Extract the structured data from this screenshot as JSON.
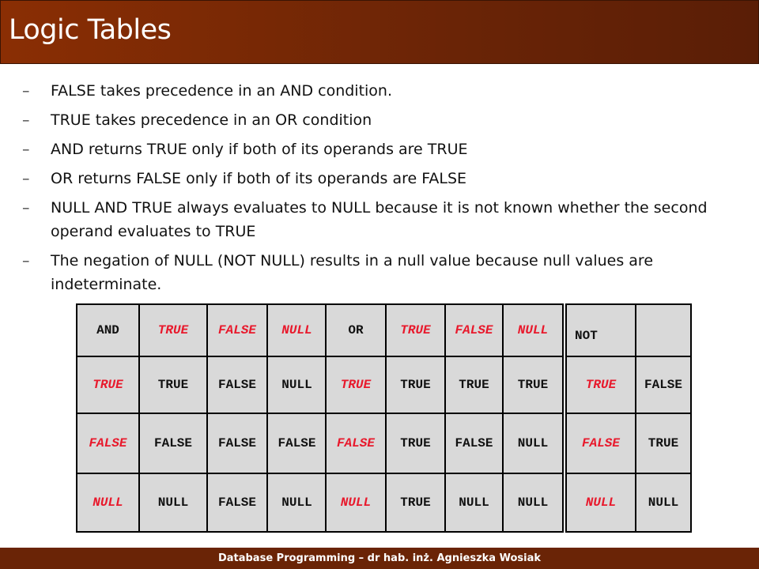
{
  "slide": {
    "title": "Logic Tables",
    "bullets": [
      "FALSE takes precedence in an AND condition.",
      "TRUE takes precedence in an OR condition",
      "AND returns TRUE only if both of its operands are TRUE",
      "OR returns FALSE only if both of its operands are FALSE",
      "NULL AND TRUE always evaluates to NULL because it is not known whether the second operand evaluates to TRUE",
      "The negation of NULL (NOT NULL) results in a null value because null values are indeterminate."
    ],
    "bullet_marker": "–",
    "footer": "Database Programming – dr hab. inż. Agnieszka Wosiak"
  },
  "and_table": {
    "operator": "AND",
    "columns": [
      "TRUE",
      "FALSE",
      "NULL"
    ],
    "rows": [
      {
        "label": "TRUE",
        "cells": [
          "TRUE",
          "FALSE",
          "NULL"
        ]
      },
      {
        "label": "FALSE",
        "cells": [
          "FALSE",
          "FALSE",
          "FALSE"
        ]
      },
      {
        "label": "NULL",
        "cells": [
          "NULL",
          "FALSE",
          "NULL"
        ]
      }
    ]
  },
  "or_table": {
    "operator": "OR",
    "columns": [
      "TRUE",
      "FALSE",
      "NULL"
    ],
    "rows": [
      {
        "label": "TRUE",
        "cells": [
          "TRUE",
          "TRUE",
          "TRUE"
        ]
      },
      {
        "label": "FALSE",
        "cells": [
          "TRUE",
          "FALSE",
          "NULL"
        ]
      },
      {
        "label": "NULL",
        "cells": [
          "TRUE",
          "NULL",
          "NULL"
        ]
      }
    ]
  },
  "not_table": {
    "operator": "NOT",
    "rows": [
      {
        "label": "TRUE",
        "cells": [
          "FALSE"
        ]
      },
      {
        "label": "FALSE",
        "cells": [
          "TRUE"
        ]
      },
      {
        "label": "NULL",
        "cells": [
          "NULL"
        ]
      }
    ]
  },
  "colors": {
    "title_bar": "#6a2406",
    "header_text": "#e8192c",
    "table_fill": "#d9d9d9"
  }
}
